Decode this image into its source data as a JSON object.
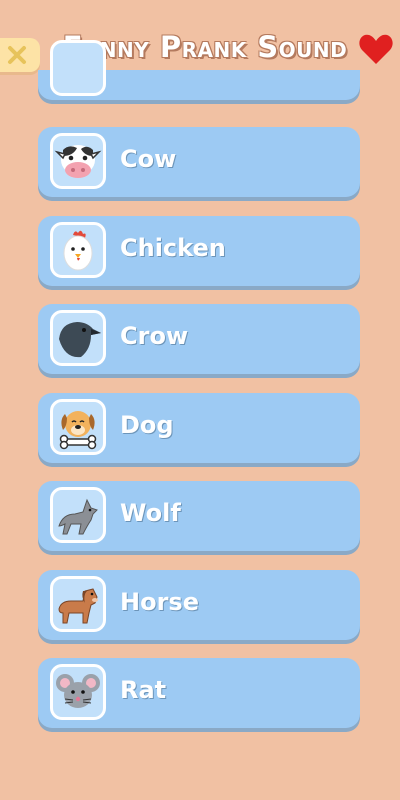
{
  "header": {
    "title": "Funny Prank Sound",
    "close_icon": "close-icon",
    "favorite_icon": "heart-icon",
    "accent_color": "#e02020"
  },
  "sounds": [
    {
      "label": "Cow",
      "icon": "cow-icon"
    },
    {
      "label": "Chicken",
      "icon": "chicken-icon"
    },
    {
      "label": "Crow",
      "icon": "crow-icon"
    },
    {
      "label": "Dog",
      "icon": "dog-icon"
    },
    {
      "label": "Wolf",
      "icon": "wolf-icon"
    },
    {
      "label": "Horse",
      "icon": "horse-icon"
    },
    {
      "label": "Rat",
      "icon": "rat-icon"
    }
  ]
}
